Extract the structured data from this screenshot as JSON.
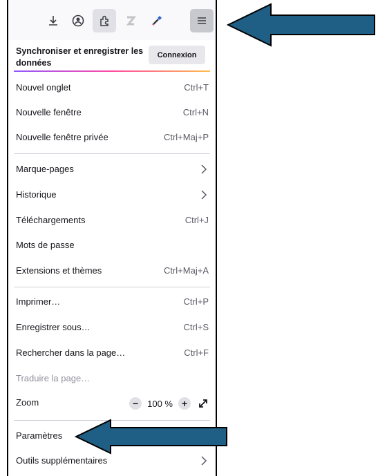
{
  "toolbar": {
    "icons": [
      "download-icon",
      "account-icon",
      "extensions-icon",
      "zotero-icon",
      "eyedropper-icon",
      "hamburger-menu-icon"
    ]
  },
  "sync": {
    "label": "Synchroniser et enregistrer les données",
    "button": "Connexion"
  },
  "menu": {
    "new_tab": {
      "label": "Nouvel onglet",
      "shortcut": "Ctrl+T"
    },
    "new_window": {
      "label": "Nouvelle fenêtre",
      "shortcut": "Ctrl+N"
    },
    "private_window": {
      "label": "Nouvelle fenêtre privée",
      "shortcut": "Ctrl+Maj+P"
    },
    "bookmarks": {
      "label": "Marque-pages"
    },
    "history": {
      "label": "Historique"
    },
    "downloads": {
      "label": "Téléchargements",
      "shortcut": "Ctrl+J"
    },
    "passwords": {
      "label": "Mots de passe"
    },
    "addons": {
      "label": "Extensions et thèmes",
      "shortcut": "Ctrl+Maj+A"
    },
    "print": {
      "label": "Imprimer…",
      "shortcut": "Ctrl+P"
    },
    "save_as": {
      "label": "Enregistrer sous…",
      "shortcut": "Ctrl+S"
    },
    "find": {
      "label": "Rechercher dans la page…",
      "shortcut": "Ctrl+F"
    },
    "translate": {
      "label": "Traduire la page…"
    },
    "zoom": {
      "label": "Zoom",
      "minus": "−",
      "value": "100 %",
      "plus": "+"
    },
    "settings": {
      "label": "Paramètres"
    },
    "more_tools": {
      "label": "Outils supplémentaires"
    }
  },
  "colors": {
    "arrow_fill": "#1f5f85",
    "arrow_stroke": "#000000",
    "gradient": [
      "#9059ff",
      "#ff4aa2",
      "#ffbd4f"
    ]
  }
}
